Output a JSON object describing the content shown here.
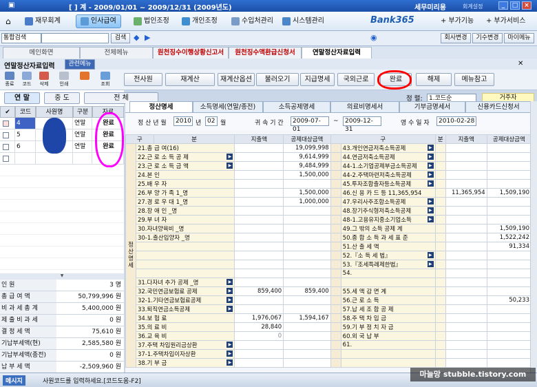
{
  "window": {
    "title": "[ ] 계 - 2009/01/01 ~ 2009/12/31 (2009년도)",
    "company": "세무미리용",
    "user": "회계설정"
  },
  "menu": [
    {
      "label": "재무회계"
    },
    {
      "label": "인사급여",
      "active": true
    },
    {
      "label": "법인조정"
    },
    {
      "label": "개인조정"
    },
    {
      "label": "수입처관리"
    },
    {
      "label": "시스템관리"
    }
  ],
  "brand": {
    "logo": "Bank365",
    "right_items": [
      "부가기능",
      "부가서비스"
    ]
  },
  "search": {
    "label": "통합검색",
    "button": "검색",
    "right_buttons": [
      "회사변경",
      "기수변경",
      "마이메뉴"
    ]
  },
  "window_tabs": [
    {
      "label": "메인화면"
    },
    {
      "label": "전체메뉴"
    },
    {
      "label": "원천징수이행상황신고서",
      "red": true
    },
    {
      "label": "원천징수액환급신청서",
      "red": true
    },
    {
      "label": "연말정산자료입력",
      "active": true
    }
  ],
  "page": {
    "title": "연말정산자료입력",
    "menu": "관련메뉴"
  },
  "toolbar": {
    "icons": [
      "종료",
      "코드",
      "삭제",
      "인쇄",
      "조회"
    ],
    "buttons": [
      "전사원",
      "재계산",
      "재계산옵션",
      "불러오기",
      "지급명세",
      "국외근로",
      "완료",
      "해제",
      "메뉴참고"
    ]
  },
  "left": {
    "groups": [
      "연 말",
      "중 도",
      "전 체"
    ],
    "headers": [
      "코드",
      "사원명",
      "구분",
      "자료"
    ],
    "rows": [
      {
        "code": "4",
        "type": "연말",
        "status": "완료",
        "checked": true
      },
      {
        "code": "5",
        "type": "연말",
        "status": "완료"
      },
      {
        "code": "6",
        "type": "연말",
        "status": "완료"
      },
      {
        "code": "",
        "type": "",
        "status": ""
      }
    ],
    "summary": [
      [
        "인 원",
        "3 명"
      ],
      [
        "총 급 여 액",
        "50,799,996 원"
      ],
      [
        "비 과 세 총 계",
        "5,400,000 원"
      ],
      [
        "제 출 비 과 세",
        "0 원"
      ],
      [
        "결 정 세 액",
        "75,610 원"
      ],
      [
        "기납부세액(현)",
        "2,585,580 원"
      ],
      [
        "기납부세액(종전)",
        "0 원"
      ],
      [
        "납 부 세 액",
        "-2,509,960 원"
      ]
    ]
  },
  "sort": {
    "label": "정 렬:",
    "value": "1.코드순"
  },
  "residency": "거주자",
  "form_tabs": [
    "정산명세",
    "소득명세(연말/종전)",
    "소득공제명세",
    "의료비명세서",
    "기부금명세서",
    "신용카드신청서"
  ],
  "settle": {
    "year_label": "정 산 년 월",
    "year": "2010",
    "year_unit": "년",
    "month": "02",
    "month_unit": "월",
    "period_label": "귀 속 기 간",
    "from": "2009-07-01",
    "to": "2009-12-31",
    "date_label": "영 수 일 자",
    "date": "2010-02-28"
  },
  "table": {
    "headers": [
      "구",
      "분",
      "지출액",
      "공제대상금액"
    ],
    "side": "정 산 명 세",
    "left_rows": [
      [
        "21.총 급 여(16)",
        "",
        "",
        "19,099,998"
      ],
      [
        "22.근 로 소 득 공 제",
        "",
        "",
        "9,614,999"
      ],
      [
        "23.근 로 소 득 금 액",
        "",
        "",
        "9,484,999"
      ],
      [
        "24.본 인",
        "",
        "",
        "1,500,000"
      ],
      [
        "25.배 우 자",
        "",
        "",
        ""
      ],
      [
        "26.부 양 가 족 1_명",
        "",
        "",
        "1,500,000"
      ],
      [
        "27.경 로 우 대 1_명",
        "",
        "",
        "1,000,000"
      ],
      [
        "28.장 애 인 _명",
        "",
        "",
        ""
      ],
      [
        "29.부 녀 자",
        "",
        "",
        ""
      ],
      [
        "30.자녀양육비 _명",
        "",
        "",
        ""
      ],
      [
        "30-1.출산입양자 _명",
        "",
        "",
        ""
      ],
      [
        "",
        "",
        "",
        ""
      ],
      [
        "",
        "",
        "",
        ""
      ],
      [
        "",
        "",
        "",
        ""
      ],
      [
        "",
        "",
        "",
        ""
      ],
      [
        "31.다자녀 추가 공제 _명",
        "",
        "",
        ""
      ],
      [
        "32.국민연금보험료 공제",
        "",
        "859,400",
        "859,400"
      ],
      [
        "32-1.기타연금보험료공제",
        "",
        "",
        ""
      ],
      [
        "33.퇴직연금소득공제",
        "",
        "",
        ""
      ],
      [
        "34.보 험 료",
        "1,976,067",
        "1,976,067",
        "1,594,167"
      ],
      [
        "35.의 료 비",
        "28,840",
        "28,840",
        ""
      ],
      [
        "36.교 육 비",
        "0",
        "",
        ""
      ],
      [
        "37.주택 차입원리금상환",
        "",
        "",
        ""
      ],
      [
        "37-1.주택차입이자상환",
        "",
        "",
        ""
      ],
      [
        "38.기 부 금",
        "",
        "",
        ""
      ]
    ],
    "right_rows": [
      [
        "43.개인연금저축소득공제",
        "",
        ""
      ],
      [
        "44.연금저축소득공제",
        "",
        ""
      ],
      [
        "44-1.소기업공제부금소득공제",
        "",
        ""
      ],
      [
        "44-2.주택마련저축소득공제",
        "",
        ""
      ],
      [
        "45.투자조합출자등소득공제",
        "",
        ""
      ],
      [
        "46.신 용 카 드 등 11,365,954",
        "11,365,954",
        "1,509,190"
      ],
      [
        "47.우리사주조합소득공제",
        "",
        ""
      ],
      [
        "48.장기주식형저축소득공제",
        "",
        ""
      ],
      [
        "48-1.고용유지중소기업소득",
        "",
        ""
      ],
      [
        "49.그 밖의 소득 공제 계",
        "",
        "1,509,190"
      ],
      [
        "50.종 합 소 득 과 세 표 준",
        "",
        "1,522,242"
      ],
      [
        "51.산 출 세 액",
        "",
        "91,334"
      ],
      [
        "52.『소 득 세 법』",
        "",
        ""
      ],
      [
        "53.『조세특례제한법』",
        "",
        ""
      ],
      [
        "54.",
        "",
        ""
      ],
      [
        "",
        "",
        ""
      ],
      [
        "55.세 액 감 면 계",
        "",
        ""
      ],
      [
        "56.근 로 소 득",
        "",
        "50,233"
      ],
      [
        "57.납 세 조 합 공 제",
        "",
        ""
      ],
      [
        "58.주 택 차 입 금",
        "",
        ""
      ],
      [
        "59.기 부 정 치 자 금",
        "",
        ""
      ],
      [
        "60.외 국 납 부",
        "",
        ""
      ],
      [
        "61.",
        "",
        ""
      ]
    ]
  },
  "status": {
    "label": "메시지",
    "text": "사원코드를 입력하세요.[코드도움-F2]"
  },
  "watermark": "마늘망 stubble.tistory.com"
}
